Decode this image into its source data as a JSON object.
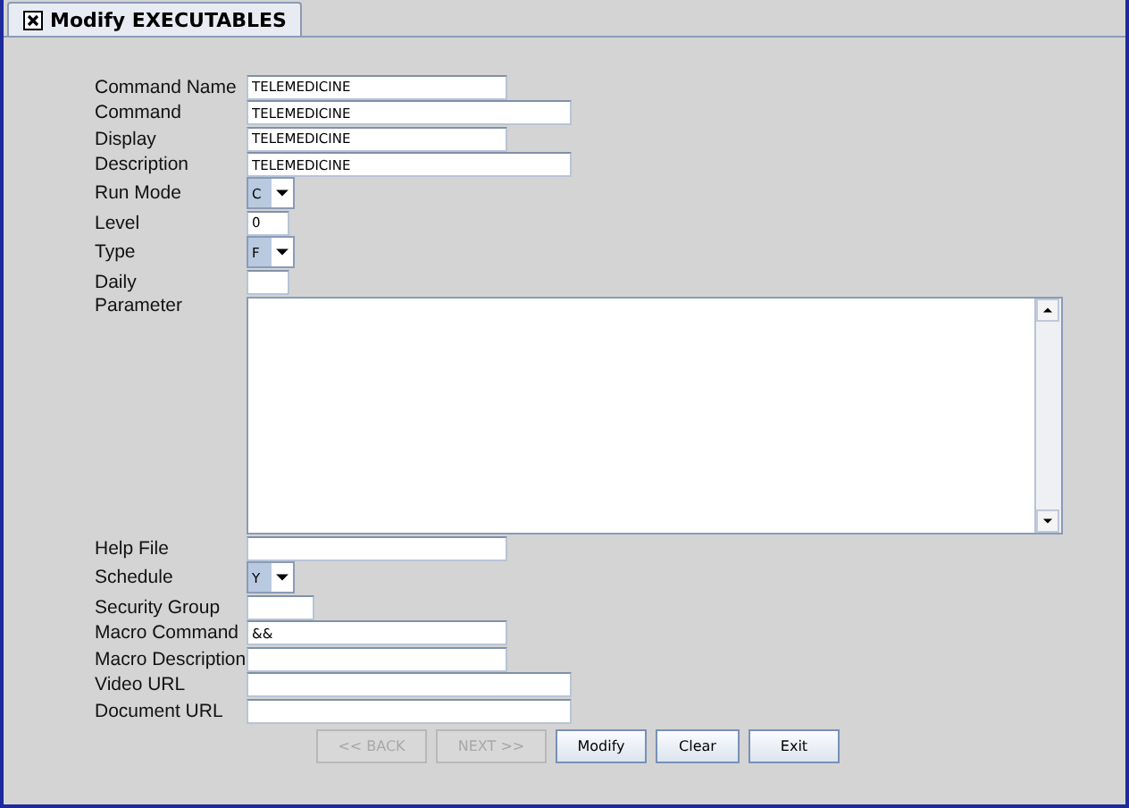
{
  "tab": {
    "label": "Modify EXECUTABLES",
    "selected": true
  },
  "fields": [
    {
      "kind": "text",
      "label": "Command Name",
      "value": "TELEMEDICINE"
    },
    {
      "kind": "text",
      "label": "Command",
      "value": "TELEMEDICINE"
    },
    {
      "kind": "text",
      "label": "Display",
      "value": "TELEMEDICINE"
    },
    {
      "kind": "text",
      "label": "Description",
      "value": "TELEMEDICINE"
    },
    {
      "kind": "combo",
      "label": "Run Mode",
      "value": "C"
    },
    {
      "kind": "text",
      "label": "Level",
      "value": "0"
    },
    {
      "kind": "combo",
      "label": "Type",
      "value": "F"
    },
    {
      "kind": "text",
      "label": "Daily"
    },
    {
      "kind": "textarea",
      "label": "Parameter"
    },
    {
      "kind": "text",
      "label": "Help File"
    },
    {
      "kind": "combo",
      "label": "Schedule",
      "value": "Y"
    },
    {
      "kind": "text",
      "label": "Security Group"
    },
    {
      "kind": "text",
      "label": "Macro Command",
      "value": "&&"
    },
    {
      "kind": "text",
      "label": "Macro Description"
    },
    {
      "kind": "text",
      "label": "Video URL"
    },
    {
      "kind": "text",
      "label": "Document URL"
    }
  ],
  "buttons": [
    {
      "label": "<< BACK",
      "disabled": true
    },
    {
      "label": "NEXT >>",
      "disabled": true
    },
    {
      "label": "Modify",
      "disabled": false
    },
    {
      "label": "Clear",
      "disabled": false
    },
    {
      "label": "Exit",
      "disabled": false
    }
  ]
}
